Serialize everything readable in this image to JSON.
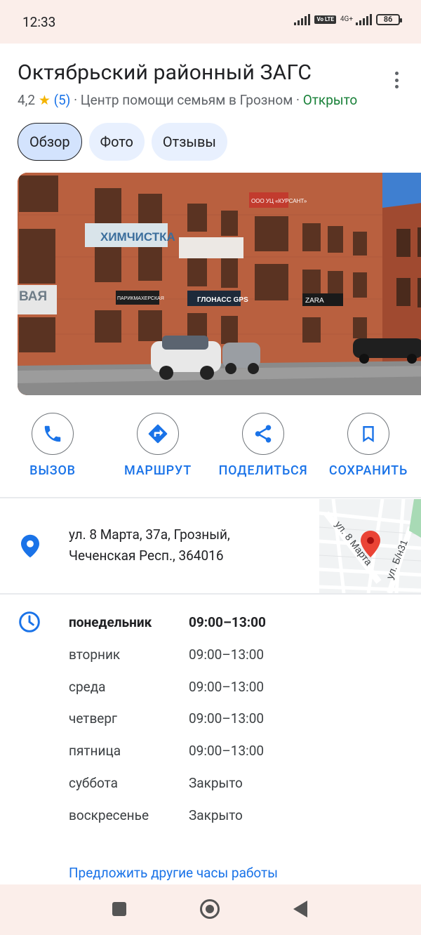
{
  "status_bar": {
    "time": "12:33",
    "volte": "Vo LTE",
    "network": "4G+",
    "battery": "86"
  },
  "place": {
    "title": "Октябрьский районный ЗАГС",
    "rating": "4,2",
    "star": "★",
    "reviews": "(5)",
    "category": "· Центр помощи семьям в Грозном ·",
    "status": "Открыто"
  },
  "tabs": [
    {
      "label": "Обзор",
      "active": true
    },
    {
      "label": "Фото",
      "active": false
    },
    {
      "label": "Отзывы",
      "active": false
    }
  ],
  "photo": {
    "signs": [
      "ХИМЧИСТКА",
      "ООО УЦ «КУРСАНТ»",
      "ПАРИКМАХЕРСКАЯ",
      "ГЛОНАСС GPS",
      "ZARA",
      "ВАЯ"
    ]
  },
  "actions": [
    {
      "label": "ВЫЗОВ",
      "icon": "phone-icon"
    },
    {
      "label": "МАРШРУТ",
      "icon": "directions-icon"
    },
    {
      "label": "ПОДЕЛИТЬСЯ",
      "icon": "share-icon"
    },
    {
      "label": "СОХРАНИТЬ",
      "icon": "bookmark-icon"
    }
  ],
  "address": {
    "line1": "ул. 8 Марта, 37а, Грозный,",
    "line2": "Чеченская Респ., 364016",
    "map_label_1": "ул. 8 Марта",
    "map_label_2": "ул. Б/н31"
  },
  "hours": [
    {
      "day": "понедельник",
      "time": "09:00–13:00",
      "today": true
    },
    {
      "day": "вторник",
      "time": "09:00–13:00",
      "today": false
    },
    {
      "day": "среда",
      "time": "09:00–13:00",
      "today": false
    },
    {
      "day": "четверг",
      "time": "09:00–13:00",
      "today": false
    },
    {
      "day": "пятница",
      "time": "09:00–13:00",
      "today": false
    },
    {
      "day": "суббота",
      "time": "Закрыто",
      "today": false
    },
    {
      "day": "воскресенье",
      "time": "Закрыто",
      "today": false
    }
  ],
  "suggest_hours": "Предложить другие часы работы",
  "colors": {
    "accent": "#1a73e8",
    "open": "#188038",
    "star": "#f4b400",
    "pin": "#ea4335"
  }
}
